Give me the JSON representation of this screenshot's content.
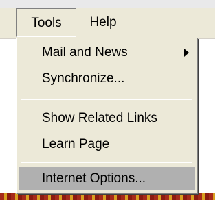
{
  "menubar": {
    "tools_label": "Tools",
    "help_label": "Help"
  },
  "tools_menu": {
    "items": [
      {
        "label": "Mail and News",
        "has_submenu": true
      },
      {
        "label": "Synchronize..."
      },
      {
        "label": "Show Related Links"
      },
      {
        "label": "Learn Page"
      },
      {
        "label": "Internet Options...",
        "highlighted": true
      }
    ]
  },
  "colors": {
    "menu_background": "#ece9d8",
    "highlight": "#b0b0b0"
  }
}
